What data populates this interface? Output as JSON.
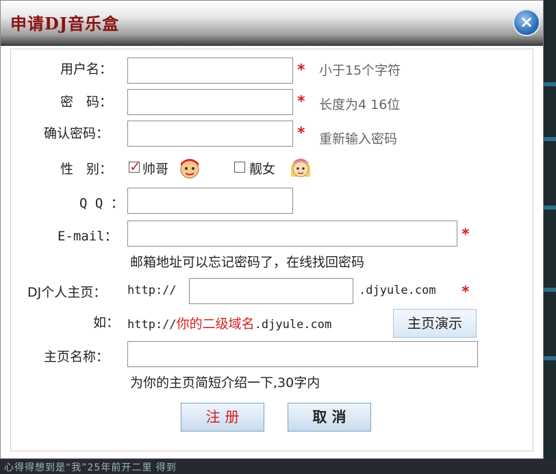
{
  "dialog": {
    "title": "申请DJ音乐盒",
    "close_glyph": "×"
  },
  "form": {
    "username": {
      "label": "用户名：",
      "value": "",
      "hint": "小于15个字符",
      "required": "*"
    },
    "password": {
      "label": "密　码：",
      "value": "",
      "hint": "长度为4 16位",
      "required": "*"
    },
    "confirm": {
      "label": "确认密码：",
      "value": "",
      "hint": "重新输入密码",
      "required": "*"
    },
    "gender": {
      "label": "性　别：",
      "male": "帅哥",
      "female": "靓女",
      "selected": "male"
    },
    "qq": {
      "label": "Q Q ：",
      "value": ""
    },
    "email": {
      "label": "E-mail：",
      "value": "",
      "required": "*",
      "hint": "邮箱地址可以忘记密码了，在线找回密码"
    },
    "homepage": {
      "label": "DJ个人主页：",
      "prefix": "http://",
      "value": "",
      "suffix": ".djyule.com",
      "required": "*"
    },
    "example": {
      "label": "如：",
      "prefix": "http://",
      "highlight": "你的二级域名",
      "suffix": ".djyule.com",
      "demo_button": "主页演示"
    },
    "homepage_name": {
      "label": "主页名称：",
      "value": "",
      "hint": "为你的主页简短介绍一下,30字内"
    }
  },
  "buttons": {
    "register": "注 册",
    "cancel": "取 消"
  },
  "background": {
    "bottom_text": "心得得想到是“我”25年前开二里  得到"
  }
}
